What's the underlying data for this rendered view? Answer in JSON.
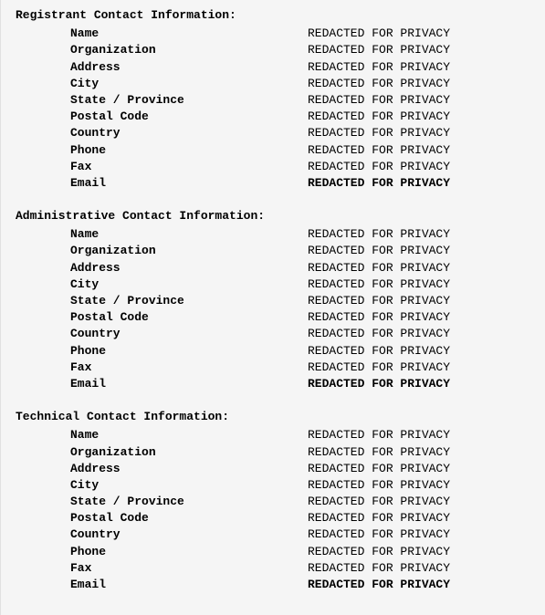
{
  "sections": [
    {
      "title": "Registrant Contact Information:",
      "fields": [
        {
          "label": "Name",
          "value": "REDACTED FOR PRIVACY",
          "bold": false
        },
        {
          "label": "Organization",
          "value": "REDACTED FOR PRIVACY",
          "bold": false
        },
        {
          "label": "Address",
          "value": "REDACTED FOR PRIVACY",
          "bold": false
        },
        {
          "label": "City",
          "value": "REDACTED FOR PRIVACY",
          "bold": false
        },
        {
          "label": "State / Province",
          "value": "REDACTED FOR PRIVACY",
          "bold": false
        },
        {
          "label": "Postal Code",
          "value": "REDACTED FOR PRIVACY",
          "bold": false
        },
        {
          "label": "Country",
          "value": "REDACTED FOR PRIVACY",
          "bold": false
        },
        {
          "label": "Phone",
          "value": "REDACTED FOR PRIVACY",
          "bold": false
        },
        {
          "label": "Fax",
          "value": "REDACTED FOR PRIVACY",
          "bold": false
        },
        {
          "label": "Email",
          "value": "REDACTED FOR PRIVACY",
          "bold": true
        }
      ]
    },
    {
      "title": "Administrative Contact Information:",
      "fields": [
        {
          "label": "Name",
          "value": "REDACTED FOR PRIVACY",
          "bold": false
        },
        {
          "label": "Organization",
          "value": "REDACTED FOR PRIVACY",
          "bold": false
        },
        {
          "label": "Address",
          "value": "REDACTED FOR PRIVACY",
          "bold": false
        },
        {
          "label": "City",
          "value": "REDACTED FOR PRIVACY",
          "bold": false
        },
        {
          "label": "State / Province",
          "value": "REDACTED FOR PRIVACY",
          "bold": false
        },
        {
          "label": "Postal Code",
          "value": "REDACTED FOR PRIVACY",
          "bold": false
        },
        {
          "label": "Country",
          "value": "REDACTED FOR PRIVACY",
          "bold": false
        },
        {
          "label": "Phone",
          "value": "REDACTED FOR PRIVACY",
          "bold": false
        },
        {
          "label": "Fax",
          "value": "REDACTED FOR PRIVACY",
          "bold": false
        },
        {
          "label": "Email",
          "value": "REDACTED FOR PRIVACY",
          "bold": true
        }
      ]
    },
    {
      "title": "Technical Contact Information:",
      "fields": [
        {
          "label": "Name",
          "value": "REDACTED FOR PRIVACY",
          "bold": false
        },
        {
          "label": "Organization",
          "value": "REDACTED FOR PRIVACY",
          "bold": false
        },
        {
          "label": "Address",
          "value": "REDACTED FOR PRIVACY",
          "bold": false
        },
        {
          "label": "City",
          "value": "REDACTED FOR PRIVACY",
          "bold": false
        },
        {
          "label": "State / Province",
          "value": "REDACTED FOR PRIVACY",
          "bold": false
        },
        {
          "label": "Postal Code",
          "value": "REDACTED FOR PRIVACY",
          "bold": false
        },
        {
          "label": "Country",
          "value": "REDACTED FOR PRIVACY",
          "bold": false
        },
        {
          "label": "Phone",
          "value": "REDACTED FOR PRIVACY",
          "bold": false
        },
        {
          "label": "Fax",
          "value": "REDACTED FOR PRIVACY",
          "bold": false
        },
        {
          "label": "Email",
          "value": "REDACTED FOR PRIVACY",
          "bold": true
        }
      ]
    }
  ]
}
